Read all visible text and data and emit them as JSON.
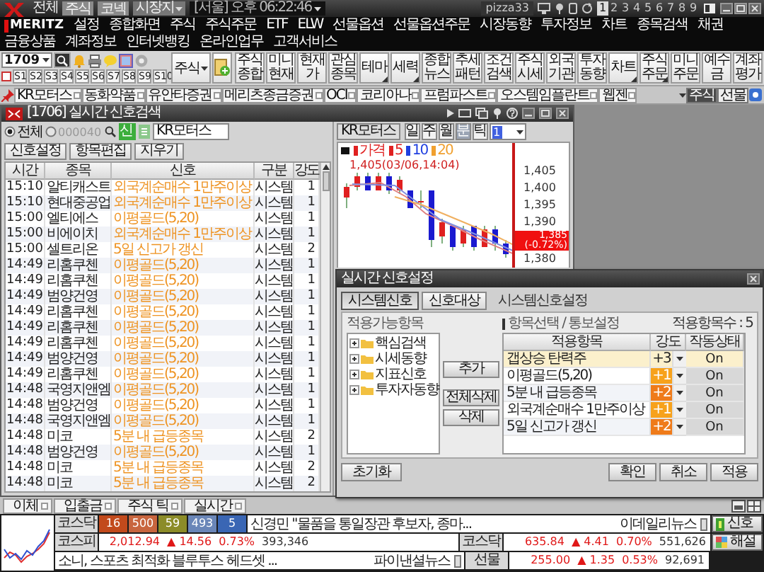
{
  "topbar": {
    "scope": "전체",
    "filters": [
      "주식",
      "코넥"
    ],
    "market_menu": "시장지",
    "clock": "[서울] 오후 06:22:46",
    "user": "pizza33",
    "screens": [
      {
        "label": "1",
        "selected": true
      },
      {
        "label": "2",
        "selected": false
      },
      {
        "label": "3",
        "selected": false
      },
      {
        "label": "4",
        "selected": false
      },
      {
        "label": "5",
        "selected": false
      },
      {
        "label": "6",
        "selected": false
      },
      {
        "label": "7",
        "selected": false
      },
      {
        "label": "8",
        "selected": false
      },
      {
        "label": "9",
        "selected": false
      }
    ]
  },
  "menu": {
    "logo": "MERITZ",
    "items": [
      "설정",
      "종합화면",
      "주식",
      "주식주문",
      "ETF",
      "ELW",
      "선물옵션",
      "선물옵션주문",
      "시장동향",
      "투자정보",
      "차트",
      "종목검색",
      "채권",
      "금융상품",
      "계좌정보",
      "인터넷뱅킹",
      "온라인업무",
      "고객서비스"
    ]
  },
  "toolbar": {
    "stock_code": "1709",
    "screen_slots": [
      "S1",
      "S2",
      "S3",
      "S4",
      "S5",
      "S6",
      "S7",
      "S8",
      "S9",
      "S10"
    ],
    "market_menu": "주식",
    "buttons": [
      {
        "label": "주식 종합",
        "has_menu": false
      },
      {
        "label": "미니 현재",
        "has_menu": false
      },
      {
        "label": "현재 가",
        "has_menu": false
      },
      {
        "label": "관심 종목",
        "has_menu": false
      },
      {
        "label": "테마",
        "has_menu": true
      },
      {
        "label": "세력",
        "has_menu": true
      },
      {
        "label": "종합 뉴스",
        "has_menu": false
      },
      {
        "label": "추세 패턴",
        "has_menu": false
      },
      {
        "label": "조건 검색",
        "has_menu": false
      },
      {
        "label": "주식 시세",
        "has_menu": false
      },
      {
        "label": "외국 기관",
        "has_menu": false
      },
      {
        "label": "투자 동향",
        "has_menu": false
      },
      {
        "label": "차트",
        "has_menu": true
      },
      {
        "label": "주식 주문",
        "has_menu": true
      },
      {
        "label": "미니 주문",
        "has_menu": false
      },
      {
        "label": "예수 금",
        "has_menu": false
      },
      {
        "label": "계좌 평가",
        "has_menu": false
      }
    ]
  },
  "stock_tabs": {
    "tabs": [
      "KR모터스",
      "동화약품",
      "유안타증권",
      "메리츠종금증권",
      "OCI",
      "코리아나",
      "프럼파스트",
      "오스템임플란트",
      "웹젠"
    ],
    "markets": [
      {
        "label": "주식",
        "selected": true
      },
      {
        "label": "선물",
        "selected": false
      }
    ]
  },
  "signal_window": {
    "title": "[1706] 실시간 신호검색",
    "scope": [
      {
        "label": "전체",
        "selected": true,
        "disabled": false
      },
      {
        "label": "000040",
        "selected": false,
        "disabled": true
      }
    ],
    "signal_badge": "신",
    "stock": "KR모터스",
    "buttons": [
      "신호설정",
      "항목편집",
      "지우기"
    ],
    "columns": [
      "시간",
      "종목",
      "신호",
      "구분",
      "강도"
    ],
    "rows": [
      {
        "time": "15:10",
        "stock": "알티캐스트",
        "signal": "외국계순매수 1만주이상",
        "type": "시스템",
        "strength": "1"
      },
      {
        "time": "15:10",
        "stock": "현대중공업",
        "signal": "외국계순매수 1만주이상",
        "type": "시스템",
        "strength": "1"
      },
      {
        "time": "15:00",
        "stock": "엘티에스",
        "signal": "이평골드(5,20)",
        "type": "시스템",
        "strength": "1"
      },
      {
        "time": "15:00",
        "stock": "비에이치",
        "signal": "외국계순매수 1만주이상",
        "type": "시스템",
        "strength": "1"
      },
      {
        "time": "15:00",
        "stock": "셀트리온",
        "signal": "5일 신고가 갱신",
        "type": "시스템",
        "strength": "2"
      },
      {
        "time": "14:49",
        "stock": "리홈쿠첸",
        "signal": "이평골드(5,20)",
        "type": "시스템",
        "strength": "1"
      },
      {
        "time": "14:49",
        "stock": "리홈쿠첸",
        "signal": "이평골드(5,20)",
        "type": "시스템",
        "strength": "1"
      },
      {
        "time": "14:49",
        "stock": "범양건영",
        "signal": "이평골드(5,20)",
        "type": "시스템",
        "strength": "1"
      },
      {
        "time": "14:49",
        "stock": "리홈쿠첸",
        "signal": "이평골드(5,20)",
        "type": "시스템",
        "strength": "1"
      },
      {
        "time": "14:49",
        "stock": "리홈쿠첸",
        "signal": "이평골드(5,20)",
        "type": "시스템",
        "strength": "1"
      },
      {
        "time": "14:49",
        "stock": "리홈쿠첸",
        "signal": "이평골드(5,20)",
        "type": "시스템",
        "strength": "1"
      },
      {
        "time": "14:49",
        "stock": "범양건영",
        "signal": "이평골드(5,20)",
        "type": "시스템",
        "strength": "1"
      },
      {
        "time": "14:49",
        "stock": "리홈쿠첸",
        "signal": "이평골드(5,20)",
        "type": "시스템",
        "strength": "1"
      },
      {
        "time": "14:48",
        "stock": "국영지앤엠",
        "signal": "이평골드(5,20)",
        "type": "시스템",
        "strength": "1"
      },
      {
        "time": "14:48",
        "stock": "범양건영",
        "signal": "이평골드(5,20)",
        "type": "시스템",
        "strength": "1"
      },
      {
        "time": "14:48",
        "stock": "국영지앤엠",
        "signal": "이평골드(5,20)",
        "type": "시스템",
        "strength": "1"
      },
      {
        "time": "14:48",
        "stock": "미코",
        "signal": "5분 내 급등종목",
        "type": "시스템",
        "strength": "2"
      },
      {
        "time": "14:48",
        "stock": "범양건영",
        "signal": "이평골드(5,20)",
        "type": "시스템",
        "strength": "1"
      },
      {
        "time": "14:48",
        "stock": "미코",
        "signal": "5분 내 급등종목",
        "type": "시스템",
        "strength": "2"
      },
      {
        "time": "14:48",
        "stock": "미코",
        "signal": "5분 내 급등종목",
        "type": "시스템",
        "strength": "2"
      }
    ]
  },
  "chart": {
    "stock": "KR모터스",
    "periods": [
      {
        "label": "일",
        "selected": false
      },
      {
        "label": "주",
        "selected": false
      },
      {
        "label": "월",
        "selected": false
      },
      {
        "label": "분",
        "selected": true
      },
      {
        "label": "틱",
        "selected": false
      }
    ],
    "interval": "1",
    "legend": [
      {
        "label": "가격",
        "color": "#e02020"
      },
      {
        "label": "5",
        "color": "#e02020"
      },
      {
        "label": "10",
        "color": "#2040e0"
      },
      {
        "label": "20",
        "color": "#f0a030"
      }
    ],
    "high_note": "1,405(03/06,14:04)",
    "axis": [
      {
        "kind": "tick",
        "label": "1,405"
      },
      {
        "kind": "tick",
        "label": "1,400"
      },
      {
        "kind": "tick",
        "label": "1,395"
      },
      {
        "kind": "tick",
        "label": "1,390"
      },
      {
        "kind": "current",
        "label": "1,385",
        "change": "(-0.72%)"
      },
      {
        "kind": "tick",
        "label": "1,380"
      }
    ]
  },
  "dialog": {
    "title": "실시간 신호설정",
    "side_buttons": [
      {
        "label": "시스템신호",
        "selected": true
      },
      {
        "label": "신호대상",
        "selected": false
      }
    ],
    "heading": "시스템신호설정",
    "available_label": "적용가능항목",
    "tree": [
      {
        "label": "핵심검색",
        "expanded": false
      },
      {
        "label": "시세동향",
        "expanded": false
      },
      {
        "label": "지표신호",
        "expanded": false
      },
      {
        "label": "투자자동향",
        "expanded": false
      }
    ],
    "actions": [
      "추가",
      "전체삭제",
      "삭제"
    ],
    "selected_label": "항목선택 / 통보설정",
    "count_label": "적용항목수 : 5",
    "columns": [
      "적용항목",
      "강도",
      "작동상태"
    ],
    "rows": [
      {
        "name": "갭상승 탄력주",
        "strength": "+3",
        "state": "On",
        "selected": true,
        "color": "#fbf0cc"
      },
      {
        "name": "이평골드(5,20)",
        "strength": "+1",
        "state": "On",
        "selected": false,
        "color": "#f7a21c"
      },
      {
        "name": "5분 내 급등종목",
        "strength": "+2",
        "state": "On",
        "selected": false,
        "color": "#ef7b1a"
      },
      {
        "name": "외국계순매수 1만주이상",
        "strength": "+1",
        "state": "On",
        "selected": false,
        "color": "#f7a21c"
      },
      {
        "name": "5일 신고가 갱신",
        "strength": "+2",
        "state": "On",
        "selected": false,
        "color": "#ef7b1a"
      }
    ],
    "reset": "초기화",
    "footer_buttons": [
      "확인",
      "취소",
      "적용"
    ]
  },
  "bottom_tabs": [
    "이체",
    "입출금",
    "주식 틱",
    "실시간"
  ],
  "status": {
    "breadth_label": "코스닥",
    "breadth": [
      {
        "value": "16",
        "color": "#c24a1c"
      },
      {
        "value": "500",
        "color": "#c8653e"
      },
      {
        "value": "59",
        "color": "#8c8c28"
      },
      {
        "value": "493",
        "color": "#6a86b8"
      },
      {
        "value": "5",
        "color": "#3a66b4"
      }
    ],
    "news": [
      {
        "headline": "신경민 \"물품을 통일장관 후보자, 종마...",
        "source": "이데일리뉴스"
      },
      {
        "headline": "소니, 스포츠 최적화 블루투스 헤드셋 ...",
        "source": "파이낸셜뉴스"
      }
    ],
    "indices": [
      {
        "name": "코스피",
        "value": "2,012.94",
        "change": "▲ 14.56",
        "rate": "0.73%",
        "volume": "393,346"
      },
      {
        "name": "코스닥",
        "value": "635.84",
        "change": "▲ 4.41",
        "rate": "0.70%",
        "volume": "551,626"
      },
      {
        "name": "선물",
        "value": "255.00",
        "change": "▲ 1.35",
        "rate": "0.53%",
        "volume": "92,691"
      }
    ],
    "buttons": [
      "신호",
      "해설"
    ]
  }
}
